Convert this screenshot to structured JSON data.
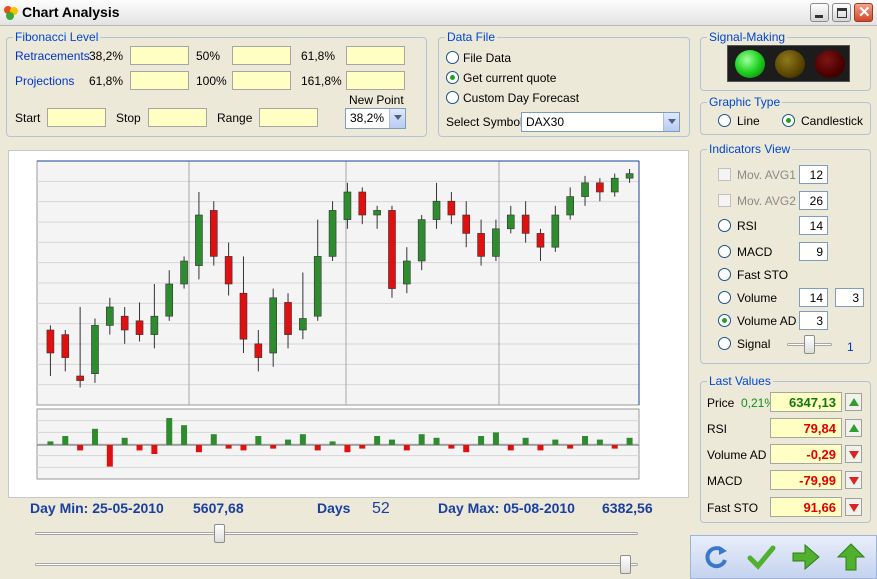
{
  "window": {
    "title": "Chart Analysis"
  },
  "fibonacci": {
    "title": "Fibonacci Level",
    "retracements_label": "Retracements",
    "projections_label": "Projections",
    "retr_levels": [
      "38,2%",
      "50%",
      "61,8%"
    ],
    "proj_levels": [
      "61,8%",
      "100%",
      "161,8%"
    ],
    "start_label": "Start",
    "stop_label": "Stop",
    "range_label": "Range",
    "new_point_label": "New Point",
    "new_point_value": "38,2%"
  },
  "data_file": {
    "title": "Data File",
    "options": [
      "File Data",
      "Get current quote",
      "Custom Day Forecast"
    ],
    "selected_index": 1,
    "select_symbol_label": "Select Symbol",
    "symbol_value": "DAX30"
  },
  "signal": {
    "title": "Signal-Making",
    "lights": [
      "#1fd11f",
      "#6b5200",
      "#5a0000"
    ]
  },
  "graphic_type": {
    "title": "Graphic Type",
    "options": [
      "Line",
      "Candlestick"
    ],
    "selected_index": 1
  },
  "indicators": {
    "title": "Indicators View",
    "items": [
      {
        "label": "Mov. AVG1",
        "kind": "check",
        "value": "12"
      },
      {
        "label": "Mov. AVG2",
        "kind": "check",
        "value": "26"
      },
      {
        "label": "RSI",
        "kind": "radio",
        "value": "14"
      },
      {
        "label": "MACD",
        "kind": "radio",
        "value": "9"
      },
      {
        "label": "Fast STO",
        "kind": "radio",
        "value": ""
      },
      {
        "label": "Volume",
        "kind": "radio",
        "value": "14",
        "value2": "3"
      },
      {
        "label": "Volume AD",
        "kind": "radio",
        "value": "3",
        "selected": true
      },
      {
        "label": "Signal",
        "kind": "radio",
        "value": ""
      }
    ],
    "signal_value": "1"
  },
  "last_values": {
    "title": "Last Values",
    "price_label": "Price",
    "price_change": "0,21%",
    "rows": [
      {
        "label": "RSI",
        "value": "79,84",
        "direction": "up",
        "color": "#e00000"
      },
      {
        "label": "Volume AD",
        "value": "-0,29",
        "direction": "down",
        "color": "#e00000"
      },
      {
        "label": "MACD",
        "value": "-79,99",
        "direction": "down",
        "color": "#e00000"
      },
      {
        "label": "Fast STO",
        "value": "91,66",
        "direction": "down",
        "color": "#e00000"
      }
    ],
    "price_value": "6347,13",
    "price_direction": "up"
  },
  "footer": {
    "day_min_label": "Day Min: 25-05-2010",
    "day_min_value": "5607,68",
    "days_label": "Days",
    "days_value": "52",
    "day_max_label": "Day Max: 05-08-2010",
    "day_max_value": "6382,56"
  },
  "chart_data": {
    "type": "candlestick",
    "candles": [
      [
        0.3,
        0.2,
        0.1,
        0.32
      ],
      [
        0.28,
        0.18,
        0.12,
        0.3
      ],
      [
        0.1,
        0.08,
        0.05,
        0.4
      ],
      [
        0.11,
        0.32,
        0.07,
        0.35
      ],
      [
        0.32,
        0.4,
        0.28,
        0.44
      ],
      [
        0.36,
        0.3,
        0.24,
        0.4
      ],
      [
        0.34,
        0.28,
        0.25,
        0.42
      ],
      [
        0.28,
        0.36,
        0.22,
        0.5
      ],
      [
        0.36,
        0.5,
        0.34,
        0.56
      ],
      [
        0.5,
        0.6,
        0.48,
        0.62
      ],
      [
        0.58,
        0.8,
        0.52,
        0.9
      ],
      [
        0.82,
        0.62,
        0.58,
        0.86
      ],
      [
        0.62,
        0.5,
        0.45,
        0.68
      ],
      [
        0.46,
        0.26,
        0.2,
        0.62
      ],
      [
        0.24,
        0.18,
        0.12,
        0.3
      ],
      [
        0.2,
        0.44,
        0.14,
        0.48
      ],
      [
        0.42,
        0.28,
        0.22,
        0.46
      ],
      [
        0.3,
        0.35,
        0.26,
        0.55
      ],
      [
        0.36,
        0.62,
        0.34,
        0.78
      ],
      [
        0.62,
        0.82,
        0.6,
        0.86
      ],
      [
        0.78,
        0.9,
        0.74,
        0.94
      ],
      [
        0.9,
        0.8,
        0.76,
        0.92
      ],
      [
        0.8,
        0.82,
        0.74,
        0.84
      ],
      [
        0.82,
        0.48,
        0.44,
        0.84
      ],
      [
        0.5,
        0.6,
        0.46,
        0.66
      ],
      [
        0.6,
        0.78,
        0.56,
        0.8
      ],
      [
        0.78,
        0.86,
        0.74,
        0.94
      ],
      [
        0.86,
        0.8,
        0.76,
        0.9
      ],
      [
        0.8,
        0.72,
        0.66,
        0.86
      ],
      [
        0.72,
        0.62,
        0.58,
        0.78
      ],
      [
        0.62,
        0.74,
        0.6,
        0.78
      ],
      [
        0.74,
        0.8,
        0.72,
        0.84
      ],
      [
        0.8,
        0.72,
        0.68,
        0.86
      ],
      [
        0.72,
        0.66,
        0.6,
        0.74
      ],
      [
        0.66,
        0.8,
        0.64,
        0.84
      ],
      [
        0.8,
        0.88,
        0.78,
        0.92
      ],
      [
        0.88,
        0.94,
        0.84,
        0.97
      ],
      [
        0.94,
        0.9,
        0.86,
        0.96
      ],
      [
        0.9,
        0.96,
        0.88,
        0.98
      ],
      [
        0.96,
        0.98,
        0.94,
        1.0
      ]
    ],
    "volume": [
      0.04,
      0.1,
      -0.06,
      0.18,
      -0.24,
      0.08,
      -0.06,
      -0.1,
      0.3,
      0.22,
      -0.08,
      0.12,
      -0.04,
      -0.06,
      0.1,
      -0.04,
      0.06,
      0.12,
      -0.06,
      0.04,
      -0.08,
      -0.04,
      0.1,
      0.06,
      -0.06,
      0.12,
      0.08,
      -0.04,
      -0.08,
      0.1,
      0.14,
      -0.06,
      0.08,
      -0.06,
      0.06,
      -0.04,
      0.1,
      0.06,
      -0.04,
      0.08
    ]
  },
  "toolbar": {
    "buttons": [
      "refresh-icon",
      "check-icon",
      "next-icon",
      "up-icon"
    ]
  }
}
